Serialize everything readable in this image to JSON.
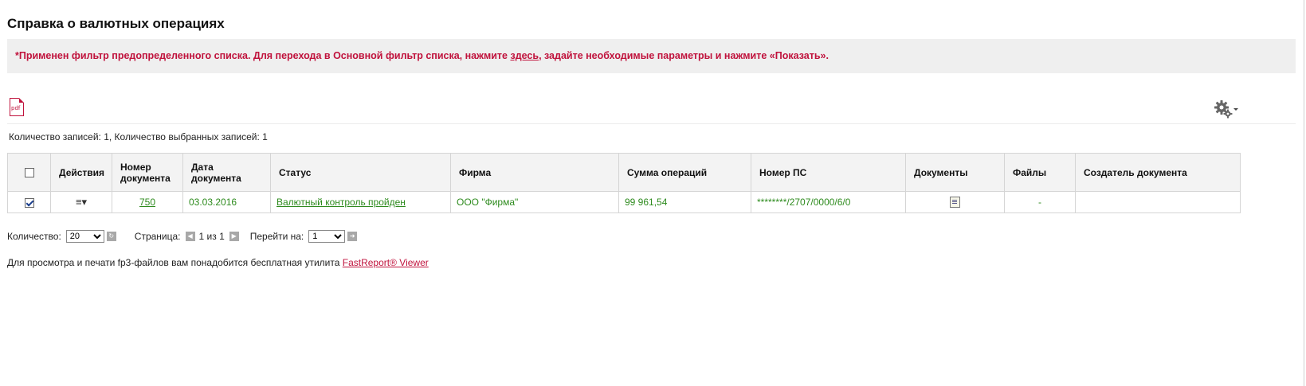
{
  "page": {
    "title": "Справка о валютных операциях"
  },
  "filter_notice": {
    "text_before": "*Применен фильтр предопределенного списка. Для перехода в Основной фильтр списка, нажмите ",
    "link_text": "здесь",
    "text_after": ", задайте необходимые параметры и нажмите «Показать»."
  },
  "toolbar": {
    "pdf_icon_label": "pdf",
    "settings_icon": "gear-icon"
  },
  "records_summary": "Количество записей: 1, Количество выбранных записей: 1",
  "table": {
    "columns": [
      "",
      "Действия",
      "Номер документа",
      "Дата документа",
      "Статус",
      "Фирма",
      "Сумма операций",
      "Номер ПС",
      "Документы",
      "Файлы",
      "Создатель документа"
    ],
    "rows": [
      {
        "checked": true,
        "actions_icon": "menu-icon",
        "doc_number": "750",
        "doc_date": "03.03.2016",
        "status": "Валютный контроль пройден",
        "firm": "ООО \"Фирма\"",
        "sum": "99 961,54",
        "ps_number": "********/2707/0000/6/0",
        "documents_icon": "document-icon",
        "files": "-",
        "creator": ""
      }
    ]
  },
  "pager": {
    "count_label": "Количество:",
    "count_value": "20",
    "page_label": "Страница:",
    "page_info": "1 из 1",
    "goto_label": "Перейти на:",
    "goto_value": "1"
  },
  "footer": {
    "text": "Для просмотра и печати fp3-файлов вам понадобится бесплатная утилита ",
    "link_text": "FastReport® Viewer"
  }
}
